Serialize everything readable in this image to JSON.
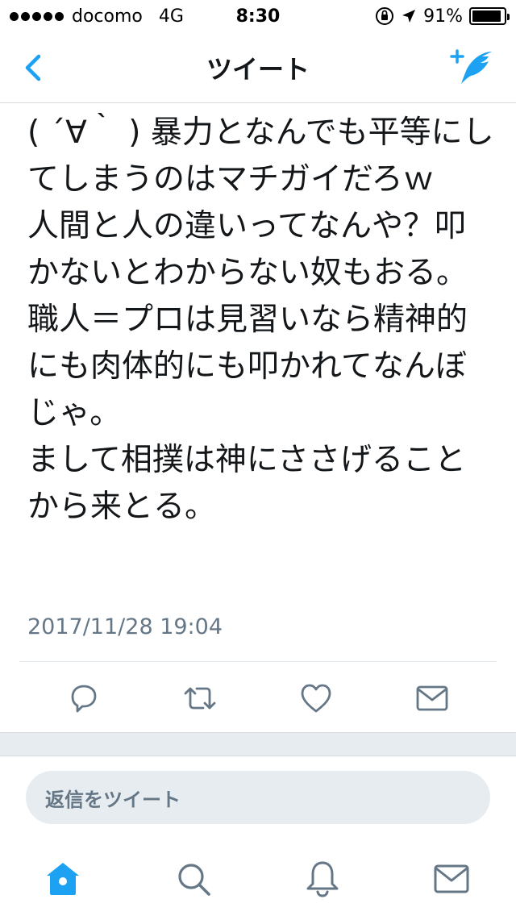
{
  "status_bar": {
    "carrier": "docomo",
    "network": "4G",
    "time": "8:30",
    "battery_percent": "91%",
    "battery_level": 0.91
  },
  "nav": {
    "title": "ツイート",
    "back_icon": "chevron-left-icon",
    "compose_icon": "compose-tweet-icon",
    "accent_color": "#1da1f2"
  },
  "tweet": {
    "text": "( ´∀｀ ) 暴力となんでも平等にしてしまうのはマチガイだろｗ\n人間と人の違いってなんや？叩かないとわからない奴もおる。職人＝プロは見習いなら精神的にも肉体的にも叩かれてなんぼじゃ。\nまして相撲は神にささげることから来とる。",
    "timestamp": "2017/11/28 19:04"
  },
  "actions": {
    "reply_icon": "reply-icon",
    "retweet_icon": "retweet-icon",
    "like_icon": "heart-icon",
    "dm_icon": "envelope-icon",
    "icon_color": "#657786"
  },
  "reply": {
    "placeholder": "返信をツイート"
  },
  "tab_bar": {
    "home_icon": "home-icon",
    "search_icon": "search-icon",
    "notifications_icon": "bell-icon",
    "messages_icon": "envelope-icon",
    "active_color": "#1da1f2",
    "inactive_color": "#657786"
  }
}
